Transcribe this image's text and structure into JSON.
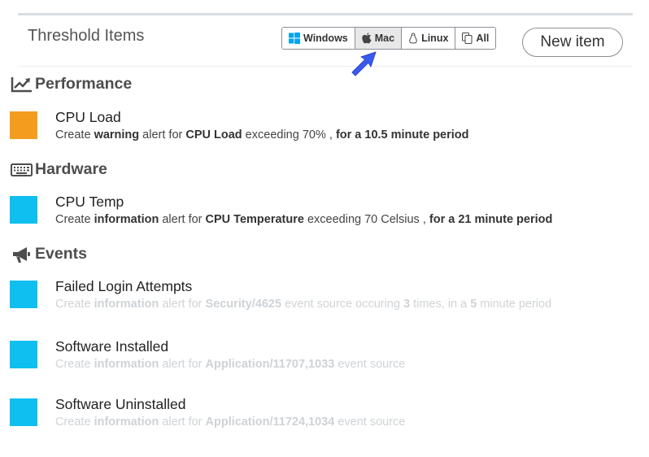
{
  "header": {
    "title": "Threshold Items",
    "new_item_label": "New item",
    "os_filters": [
      {
        "label": "Windows",
        "icon": "windows-icon",
        "active": false
      },
      {
        "label": "Mac",
        "icon": "apple-icon",
        "active": true
      },
      {
        "label": "Linux",
        "icon": "linux-icon",
        "active": false
      },
      {
        "label": "All",
        "icon": "copy-icon",
        "active": false
      }
    ]
  },
  "sections": [
    {
      "name": "Performance",
      "icon": "line-chart-icon",
      "items": [
        {
          "title": "CPU Load",
          "color": "#f39c1e",
          "desc": {
            "p1": "Create ",
            "level": "warning",
            "p2": " alert for ",
            "target": "CPU Load",
            "p3": " exceeding 70% , ",
            "period": "for a 10.5 minute period"
          }
        }
      ]
    },
    {
      "name": "Hardware",
      "icon": "keyboard-icon",
      "items": [
        {
          "title": "CPU Temp",
          "color": "#0fbfef",
          "desc": {
            "p1": "Create ",
            "level": "information",
            "p2": " alert for ",
            "target": "CPU Temperature",
            "p3": " exceeding 70 Celsius , ",
            "period": "for a 21 minute period"
          }
        }
      ]
    },
    {
      "name": "Events",
      "icon": "bullhorn-icon",
      "items": [
        {
          "title": "Failed Login Attempts",
          "color": "#0fbfef",
          "desc": {
            "p1": "Create ",
            "level": "information",
            "p2": " alert for ",
            "target": "Security/4625",
            "p3": " event source occuring ",
            "count": "3",
            "p4": " times, in a ",
            "minutes": "5",
            "p5": " minute period"
          }
        },
        {
          "title": "Software Installed",
          "color": "#0fbfef",
          "desc": {
            "p1": "Create ",
            "level": "information",
            "p2": " alert for ",
            "target": "Application/11707,1033",
            "p3": " event source"
          }
        },
        {
          "title": "Software Uninstalled",
          "color": "#0fbfef",
          "desc": {
            "p1": "Create ",
            "level": "information",
            "p2": " alert for ",
            "target": "Application/11724,1034",
            "p3": " event source"
          }
        }
      ]
    }
  ],
  "colors": {
    "warning": "#f39c1e",
    "information": "#0fbfef",
    "pointer": "#3a5bf0"
  }
}
